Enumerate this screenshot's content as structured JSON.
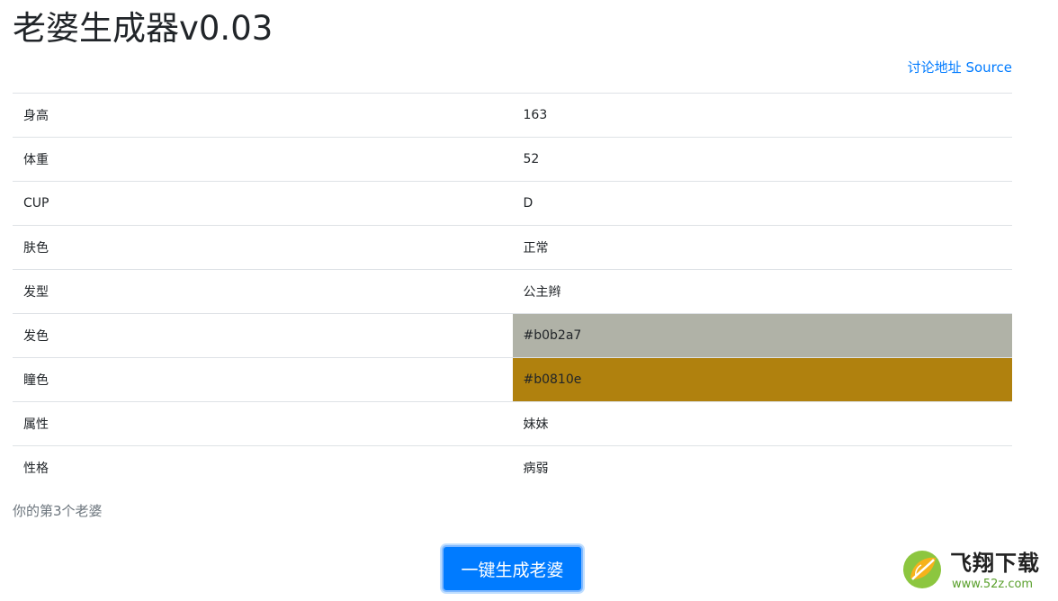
{
  "page": {
    "title": "老婆生成器v0.03",
    "links": {
      "discussion": "讨论地址",
      "source": "Source"
    }
  },
  "attributes": [
    {
      "label": "身高",
      "value": "163"
    },
    {
      "label": "体重",
      "value": "52"
    },
    {
      "label": "CUP",
      "value": "D"
    },
    {
      "label": "肤色",
      "value": "正常"
    },
    {
      "label": "发型",
      "value": "公主辫"
    },
    {
      "label": "发色",
      "value": "#b0b2a7",
      "swatch": "#b0b2a7"
    },
    {
      "label": "瞳色",
      "value": "#b0810e",
      "swatch": "#b0810e"
    },
    {
      "label": "属性",
      "value": "妹妹"
    },
    {
      "label": "性格",
      "value": "病弱"
    }
  ],
  "counter": "你的第3个老婆",
  "generate_button": "一键生成老婆",
  "watermark": {
    "name": "飞翔下载",
    "url": "www.52z.com"
  },
  "colors": {
    "primary": "#007bff",
    "hair": "#b0b2a7",
    "eye": "#b0810e"
  }
}
